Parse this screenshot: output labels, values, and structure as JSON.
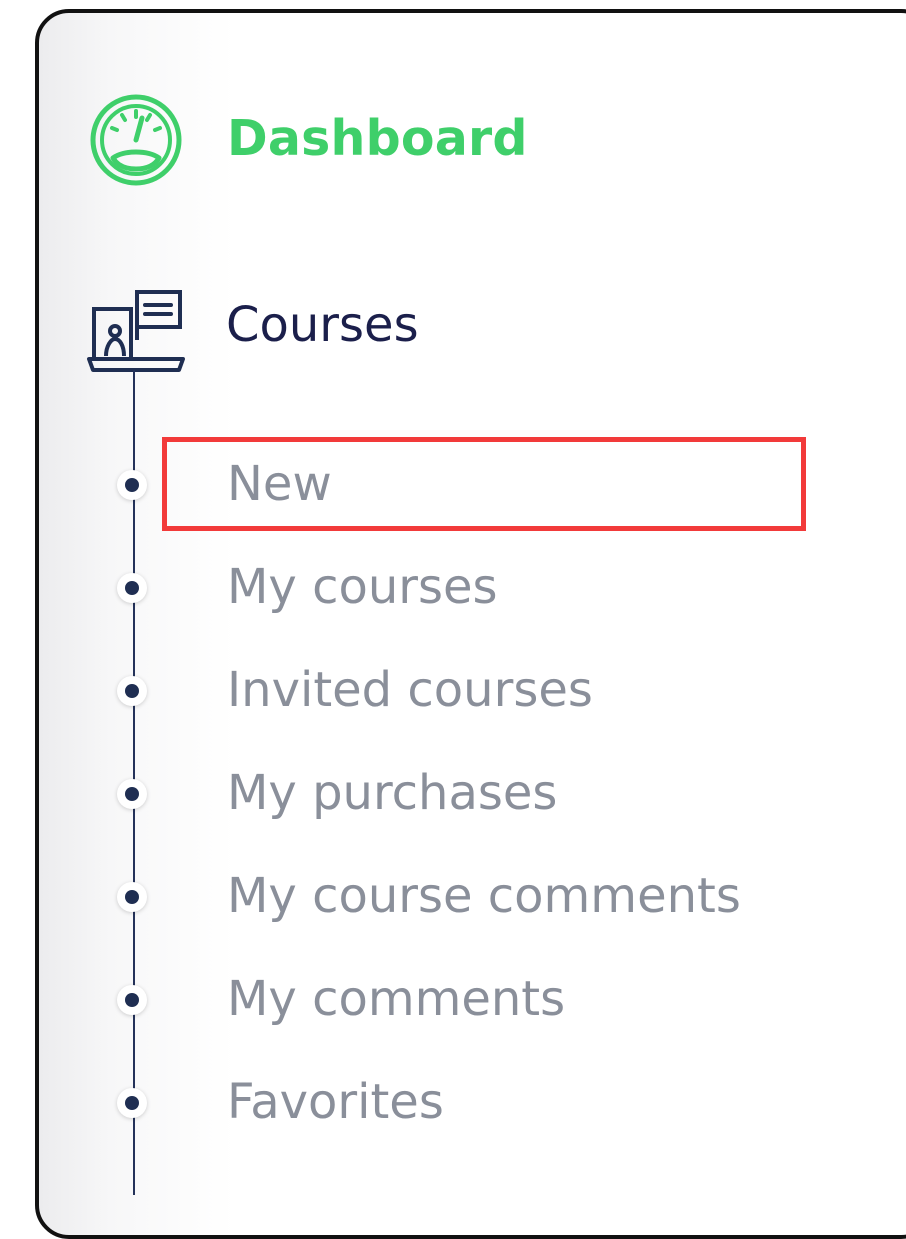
{
  "sidebar": {
    "dashboard": {
      "label": "Dashboard",
      "icon": "speedometer-icon"
    },
    "courses": {
      "label": "Courses",
      "icon": "course-board-icon"
    },
    "course_items": [
      {
        "label": "New"
      },
      {
        "label": "My courses"
      },
      {
        "label": "Invited courses"
      },
      {
        "label": "My purchases"
      },
      {
        "label": "My course comments"
      },
      {
        "label": "My comments"
      },
      {
        "label": "Favorites"
      }
    ]
  },
  "colors": {
    "active": "#3fcf6a",
    "heading": "#1b1f4b",
    "muted": "#8a8f9a",
    "bullet": "#1f2e52",
    "highlight": "#f23a3a"
  }
}
